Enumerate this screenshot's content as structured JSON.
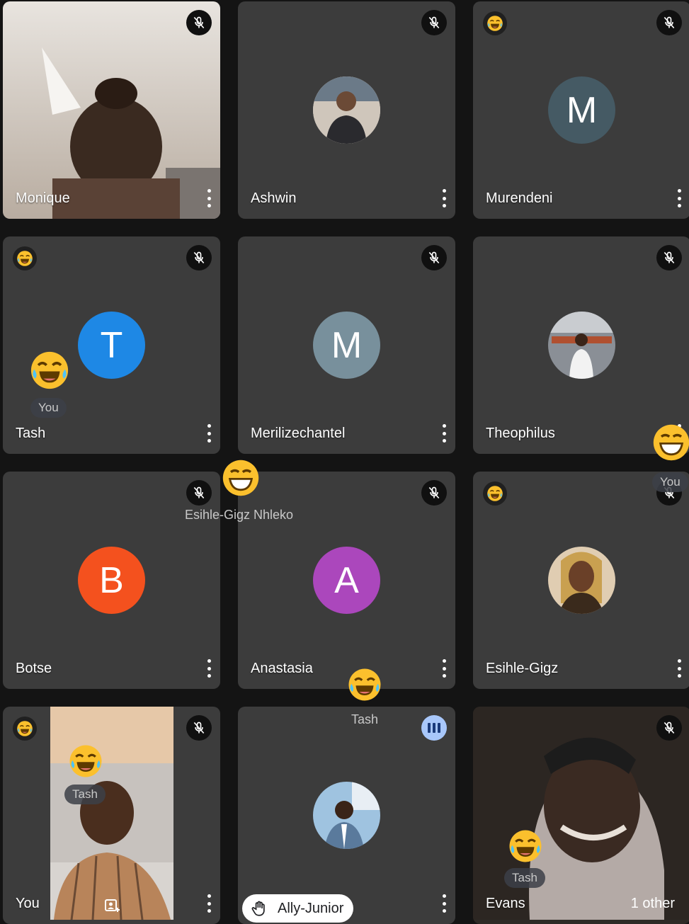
{
  "tiles": [
    {
      "name": "Monique",
      "initial": "",
      "avatar_color": "",
      "muted": true,
      "reaction": false
    },
    {
      "name": "Ashwin",
      "initial": "",
      "avatar_color": "",
      "muted": true,
      "reaction": false
    },
    {
      "name": "Murendeni",
      "initial": "M",
      "avatar_color": "#455a64",
      "muted": true,
      "reaction": true
    },
    {
      "name": "Tash",
      "initial": "T",
      "avatar_color": "#1e88e5",
      "muted": true,
      "reaction": true
    },
    {
      "name": "Merilizechantel",
      "initial": "M",
      "avatar_color": "#78909c",
      "muted": true,
      "reaction": false
    },
    {
      "name": "Theophilus",
      "initial": "",
      "avatar_color": "",
      "muted": true,
      "reaction": false
    },
    {
      "name": "Botse",
      "initial": "B",
      "avatar_color": "#f4511e",
      "muted": true,
      "reaction": false
    },
    {
      "name": "Anastasia",
      "initial": "A",
      "avatar_color": "#ab47bc",
      "muted": true,
      "reaction": false
    },
    {
      "name": "Esihle-Gigz",
      "initial": "",
      "avatar_color": "",
      "muted": true,
      "reaction": true
    },
    {
      "name": "You",
      "initial": "",
      "avatar_color": "",
      "muted": true,
      "reaction": true
    },
    {
      "name": "Ally-Junior",
      "initial": "",
      "avatar_color": "",
      "muted": false,
      "reaction": false,
      "hand_raised": true
    },
    {
      "name": "Evans",
      "extra": "1 other",
      "initial": "",
      "avatar_color": "",
      "muted": true,
      "reaction": false
    }
  ],
  "floating_labels": {
    "you_tash_tile": "You",
    "esihle_nhleko": "Esihle-Gigz Nhleko",
    "you_right_edge": "You",
    "tash_over_anastasia": "Tash",
    "tash_in_self_view": "Tash",
    "tash_in_evans": "Tash"
  },
  "icons": {
    "mute": "mic-off-icon",
    "more": "more-vert-icon",
    "reaction": "laughing-emoji-icon",
    "speaking": "audio-level-icon",
    "hand": "raised-hand-icon",
    "reframe": "reframe-icon"
  },
  "colors": {
    "tile_bg": "#3c3c3c",
    "page_bg": "#141414",
    "speaking": "#a8c7fa"
  }
}
